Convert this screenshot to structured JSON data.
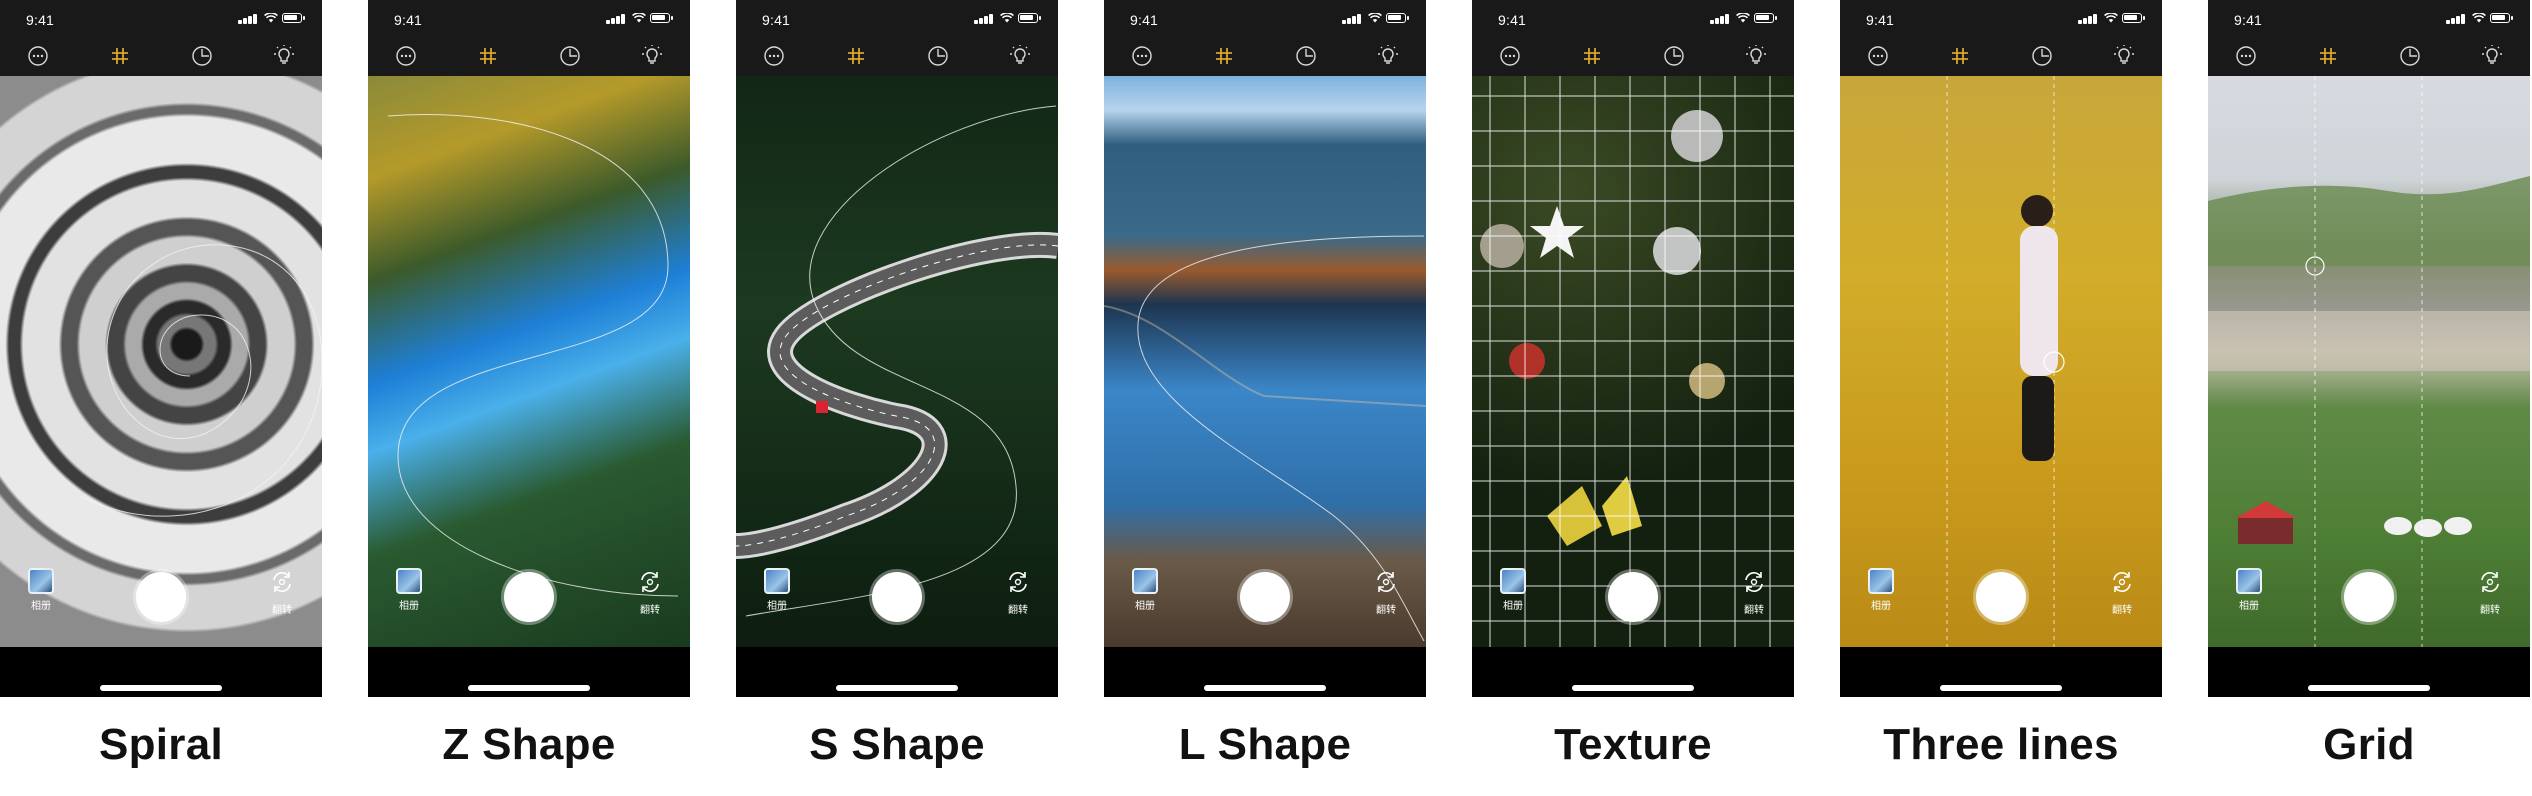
{
  "status_time": "9:41",
  "controls": {
    "album_label": "相册",
    "flip_label": "翻转"
  },
  "colors": {
    "active_tool": "#d8a531",
    "inactive_tool": "#d8d8d8",
    "bar": "#191919"
  },
  "toolbar_icons": [
    "more-icon",
    "composition-grid-icon",
    "timer-icon",
    "flash-bulb-icon"
  ],
  "panels": [
    {
      "caption": "Spiral"
    },
    {
      "caption": "Z Shape"
    },
    {
      "caption": "S Shape"
    },
    {
      "caption": "L Shape"
    },
    {
      "caption": "Texture"
    },
    {
      "caption": "Three lines"
    },
    {
      "caption": "Grid"
    }
  ]
}
